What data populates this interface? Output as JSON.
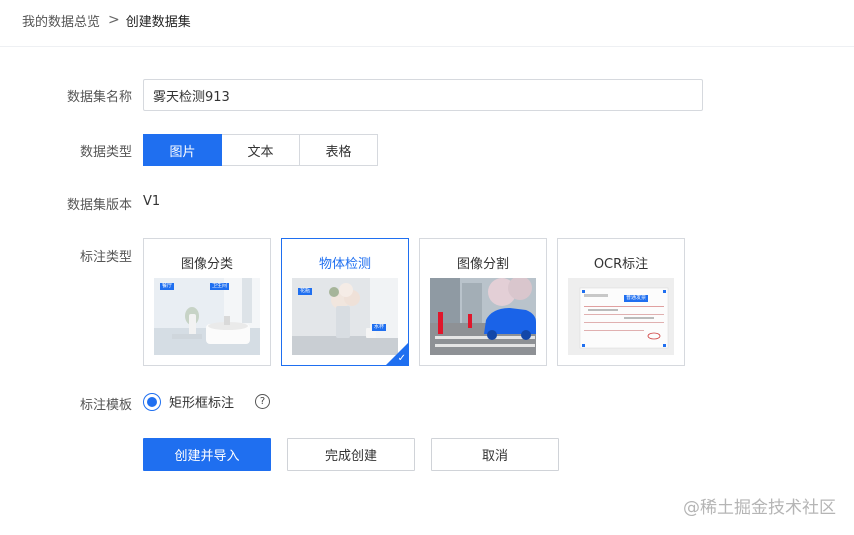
{
  "breadcrumb": {
    "parent": "我的数据总览",
    "separator": ">",
    "current": "创建数据集"
  },
  "form": {
    "name_label": "数据集名称",
    "name_value": "雾天检测913",
    "type_label": "数据类型",
    "types": [
      {
        "label": "图片",
        "active": true
      },
      {
        "label": "文本",
        "active": false
      },
      {
        "label": "表格",
        "active": false
      }
    ],
    "version_label": "数据集版本",
    "version_value": "V1",
    "annotation_label": "标注类型",
    "annotation_types": [
      {
        "label": "图像分类",
        "selected": false
      },
      {
        "label": "物体检测",
        "selected": true
      },
      {
        "label": "图像分割",
        "selected": false
      },
      {
        "label": "OCR标注",
        "selected": false
      }
    ],
    "template_label": "标注模板",
    "template_option": "矩形框标注",
    "help_glyph": "?",
    "check_glyph": "✓"
  },
  "thumb_tags": {
    "classify_1": "餐厅",
    "classify_2": "卫生间",
    "detect_1": "花瓶",
    "detect_2": "水杯",
    "ocr_1": "普通发票"
  },
  "buttons": {
    "create_import": "创建并导入",
    "finish": "完成创建",
    "cancel": "取消"
  },
  "watermark": "@稀土掘金技术社区",
  "colors": {
    "primary": "#1f6ff0",
    "border": "#d6d9de",
    "label": "#555555"
  },
  "icons": {
    "breadcrumb_separator": "chevron-right-icon",
    "selected_check": "check-icon",
    "help": "question-circle-icon"
  }
}
